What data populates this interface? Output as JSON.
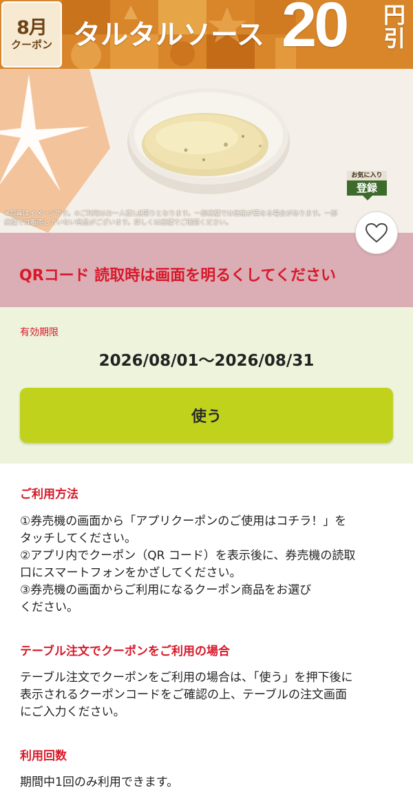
{
  "banner": {
    "month": "8月",
    "badge_label": "クーポン",
    "product_name": "タルタルソース",
    "price_number": "20",
    "price_unit": "円引"
  },
  "hero": {
    "disclaimer": "※写真はイメージです。※ご利用はお一人様1点限りとなります。一部店舗では価格が異なる場合があります。一部店舗では販売していない商品がございます。詳しくは店舗でご確認ください。",
    "favorite_badge_top": "お気に入り",
    "favorite_badge_bottom": "登録"
  },
  "notice": {
    "text": "QRコード 読取時は画面を明るくしてください"
  },
  "validity": {
    "label": "有効期限",
    "range": "2026/08/01〜2026/08/31",
    "use_button": "使う"
  },
  "sections": [
    {
      "title": "ご利用方法",
      "lines": [
        "①券売機の画面から「アプリクーポンのご使用はコチラ！」を",
        "タッチしてください。",
        "②アプリ内でクーポン（QR コード）を表示後に、券売機の読取",
        "口にスマートフォンをかざしてください。",
        "③券売機の画面からご利用になるクーポン商品をお選び",
        "ください。"
      ]
    },
    {
      "title": "テーブル注文でクーポンをご利用の場合",
      "lines": [
        "テーブル注文でクーポンをご利用の場合は、「使う」を押下後に",
        "表示されるクーポンコードをご確認の上、テーブルの注文画面",
        "にご入力ください。"
      ]
    },
    {
      "title": "利用回数",
      "lines": [
        "期間中1回のみ利用できます。"
      ]
    }
  ],
  "colors": {
    "accent_red": "#d7182a",
    "use_button": "#c1d21d",
    "notice_bg": "#dbadb4",
    "validity_bg": "#eef3dc",
    "banner_orange": "#d9862a"
  }
}
